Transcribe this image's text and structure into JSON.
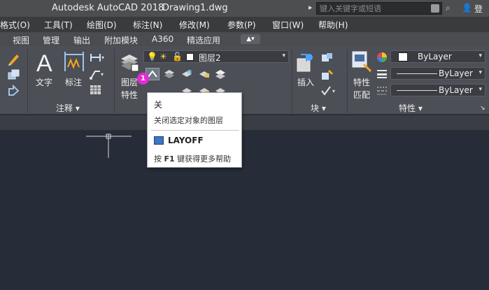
{
  "window": {
    "app_title": "Autodesk AutoCAD 2018",
    "doc_title": "Drawing1.dwg",
    "search_placeholder": "键入关键字或短语",
    "login": "登"
  },
  "menubar": {
    "items": [
      "格式(O)",
      "工具(T)",
      "绘图(D)",
      "标注(N)",
      "修改(M)",
      "参数(P)",
      "窗口(W)",
      "帮助(H)"
    ]
  },
  "tabs": {
    "items": [
      "视图",
      "管理",
      "输出",
      "附加模块",
      "A360",
      "精选应用"
    ],
    "more": "▲▾"
  },
  "ribbon": {
    "annotate": {
      "text_label": "文字",
      "dim_label": "标注",
      "footer": "注释 ▾"
    },
    "layers": {
      "properties_label_1": "图层",
      "properties_label_2": "特性",
      "current_layer": "图层2",
      "current_layer_color": "#ffffff"
    },
    "block": {
      "insert_label": "插入",
      "footer": "块 ▾"
    },
    "properties": {
      "match_label_1": "特性",
      "match_label_2": "匹配",
      "color_combo": "ByLayer",
      "linetype_combo": "ByLayer",
      "lineweight_combo": "ByLayer",
      "footer": "特性 ▾"
    },
    "step_badge": "1"
  },
  "tooltip": {
    "title": "关",
    "description": "关闭选定对象的图层",
    "command": "LAYOFF",
    "help_prefix": "按 ",
    "help_key": "F1",
    "help_suffix": " 键获得更多帮助"
  },
  "colors": {
    "canvas": "#262c38",
    "ribbon": "#4c4f55",
    "badge": "#e52bd6"
  }
}
